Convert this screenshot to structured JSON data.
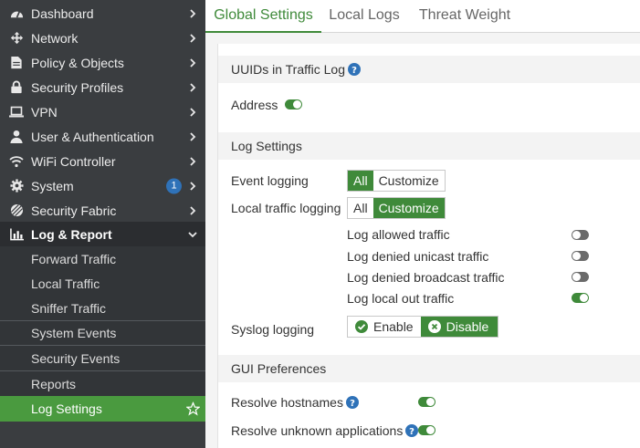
{
  "sidebar": {
    "items": [
      {
        "label": "Dashboard",
        "icon": "dashboard-icon"
      },
      {
        "label": "Network",
        "icon": "network-icon"
      },
      {
        "label": "Policy & Objects",
        "icon": "policy-icon"
      },
      {
        "label": "Security Profiles",
        "icon": "lock-icon"
      },
      {
        "label": "VPN",
        "icon": "laptop-icon"
      },
      {
        "label": "User & Authentication",
        "icon": "user-icon"
      },
      {
        "label": "WiFi Controller",
        "icon": "wifi-icon"
      },
      {
        "label": "System",
        "icon": "gear-icon",
        "badge": "1"
      },
      {
        "label": "Security Fabric",
        "icon": "fabric-icon"
      },
      {
        "label": "Log & Report",
        "icon": "chart-icon"
      }
    ],
    "sub_items": [
      {
        "label": "Forward Traffic"
      },
      {
        "label": "Local Traffic"
      },
      {
        "label": "Sniffer Traffic"
      },
      {
        "label": "System Events"
      },
      {
        "label": "Security Events"
      },
      {
        "label": "Reports"
      },
      {
        "label": "Log Settings"
      }
    ]
  },
  "tabs": [
    {
      "label": "Global Settings"
    },
    {
      "label": "Local Logs"
    },
    {
      "label": "Threat Weight"
    }
  ],
  "sections": {
    "uuid": {
      "title": "UUIDs in Traffic Log",
      "address_label": "Address"
    },
    "log_settings": {
      "title": "Log Settings",
      "event_logging_label": "Event logging",
      "event_logging_options": [
        "All",
        "Customize"
      ],
      "local_traffic_label": "Local traffic logging",
      "local_traffic_options": [
        "All",
        "Customize"
      ],
      "sub_options": [
        {
          "label": "Log allowed traffic",
          "enabled": false
        },
        {
          "label": "Log denied unicast traffic",
          "enabled": false
        },
        {
          "label": "Log denied broadcast traffic",
          "enabled": false
        },
        {
          "label": "Log local out traffic",
          "enabled": true
        }
      ],
      "syslog_label": "Syslog logging",
      "syslog_options": [
        "Enable",
        "Disable"
      ]
    },
    "gui": {
      "title": "GUI Preferences",
      "resolve_hostnames_label": "Resolve hostnames",
      "resolve_apps_label": "Resolve unknown applications"
    }
  },
  "colors": {
    "accent": "#3f8a3a",
    "selected_nav": "#4a9a3f",
    "sidebar_bg": "#3a3d40",
    "badge": "#2f72b8",
    "help": "#2f72b8"
  }
}
